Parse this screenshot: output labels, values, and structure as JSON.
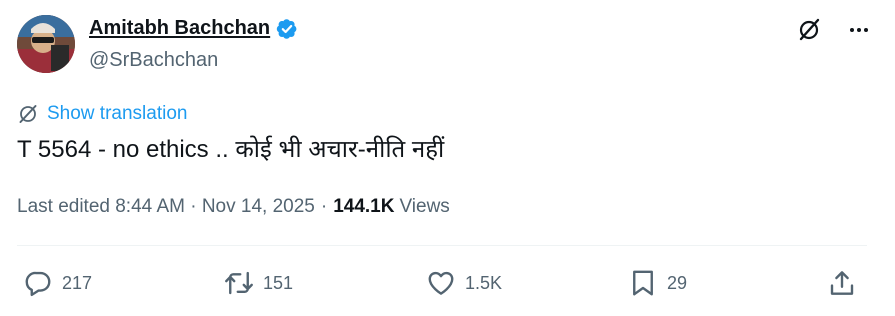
{
  "author": {
    "name": "Amitabh Bachchan",
    "handle": "@SrBachchan",
    "verified_icon": "verified-badge-icon",
    "verified_color": "#1d9bf0"
  },
  "header_actions": {
    "grok_icon": "grok-icon",
    "more_icon": "more-icon"
  },
  "translation": {
    "label": "Show translation",
    "icon": "translate-icon"
  },
  "tweet_text": "T 5564 - no ethics .. कोई भी अचार-नीति नहीं",
  "meta": {
    "edited_label": "Last edited 8:44 AM · Nov 14, 2025",
    "separator": "·",
    "views_count": "144.1K",
    "views_label": "Views"
  },
  "actions": {
    "reply": {
      "icon": "reply-icon",
      "count": "217"
    },
    "repost": {
      "icon": "repost-icon",
      "count": "151"
    },
    "like": {
      "icon": "heart-icon",
      "count": "1.5K"
    },
    "bookmark": {
      "icon": "bookmark-icon",
      "count": "29"
    },
    "share": {
      "icon": "share-icon"
    }
  },
  "colors": {
    "text_primary": "#0f1419",
    "text_secondary": "#536471",
    "accent": "#1d9bf0",
    "divider": "#eff3f4"
  }
}
